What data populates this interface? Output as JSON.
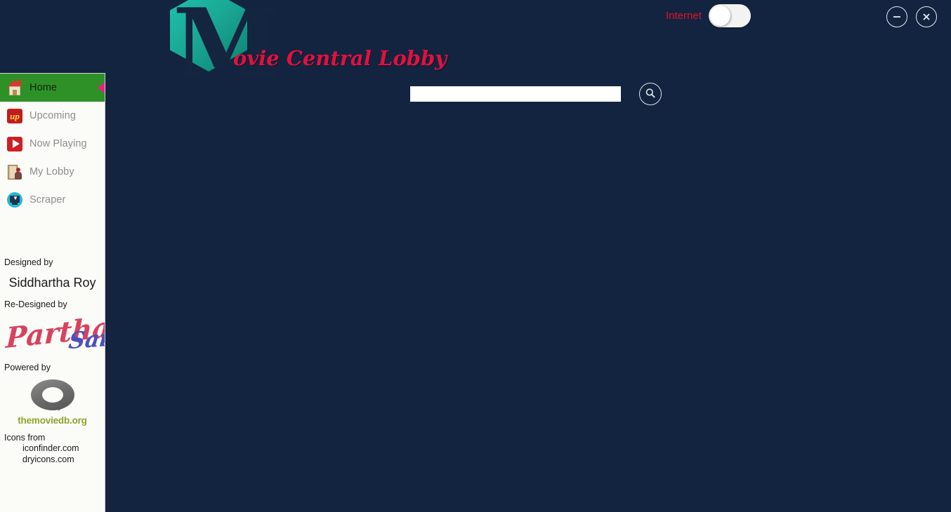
{
  "app": {
    "title": "Movie Central Lobby",
    "logo_letter": "M",
    "logo_title_visible": "ovie Central Lobby",
    "background_color": "#12243f",
    "accent_color": "#e3103f",
    "logo_color": "#19a894"
  },
  "header": {
    "internet_label": "Internet",
    "internet_label_color": "#e31225",
    "internet_toggle_state": "off",
    "minimize_icon": "minimize-icon",
    "close_icon": "close-icon"
  },
  "search": {
    "value": "",
    "placeholder": "",
    "button_icon": "search-icon"
  },
  "sidebar": {
    "items": [
      {
        "label": "Home",
        "icon": "house-icon",
        "active": true
      },
      {
        "label": "Upcoming",
        "icon": "upcoming-icon",
        "active": false
      },
      {
        "label": "Now Playing",
        "icon": "play-icon",
        "active": false
      },
      {
        "label": "My Lobby",
        "icon": "door-icon",
        "active": false
      },
      {
        "label": "Scraper",
        "icon": "scraper-icon",
        "active": false
      }
    ],
    "active_color": "#2e9128",
    "pointer_color": "#ea2080",
    "credits": {
      "designed_by_label": "Designed by",
      "designer_name": "Siddhartha Roy",
      "redesigned_by_label": "Re-Designed by",
      "signature_first": "Partha",
      "signature_second": "Sai",
      "signature_first_color": "#d8425e",
      "signature_second_color": "#4a4fc0",
      "powered_by_label": "Powered by",
      "powered_by_name": "themoviedb.org",
      "powered_by_color": "#8fa32a",
      "icons_from_label": "Icons from",
      "icons_sources": [
        "iconfinder.com",
        "dryicons.com"
      ]
    }
  }
}
